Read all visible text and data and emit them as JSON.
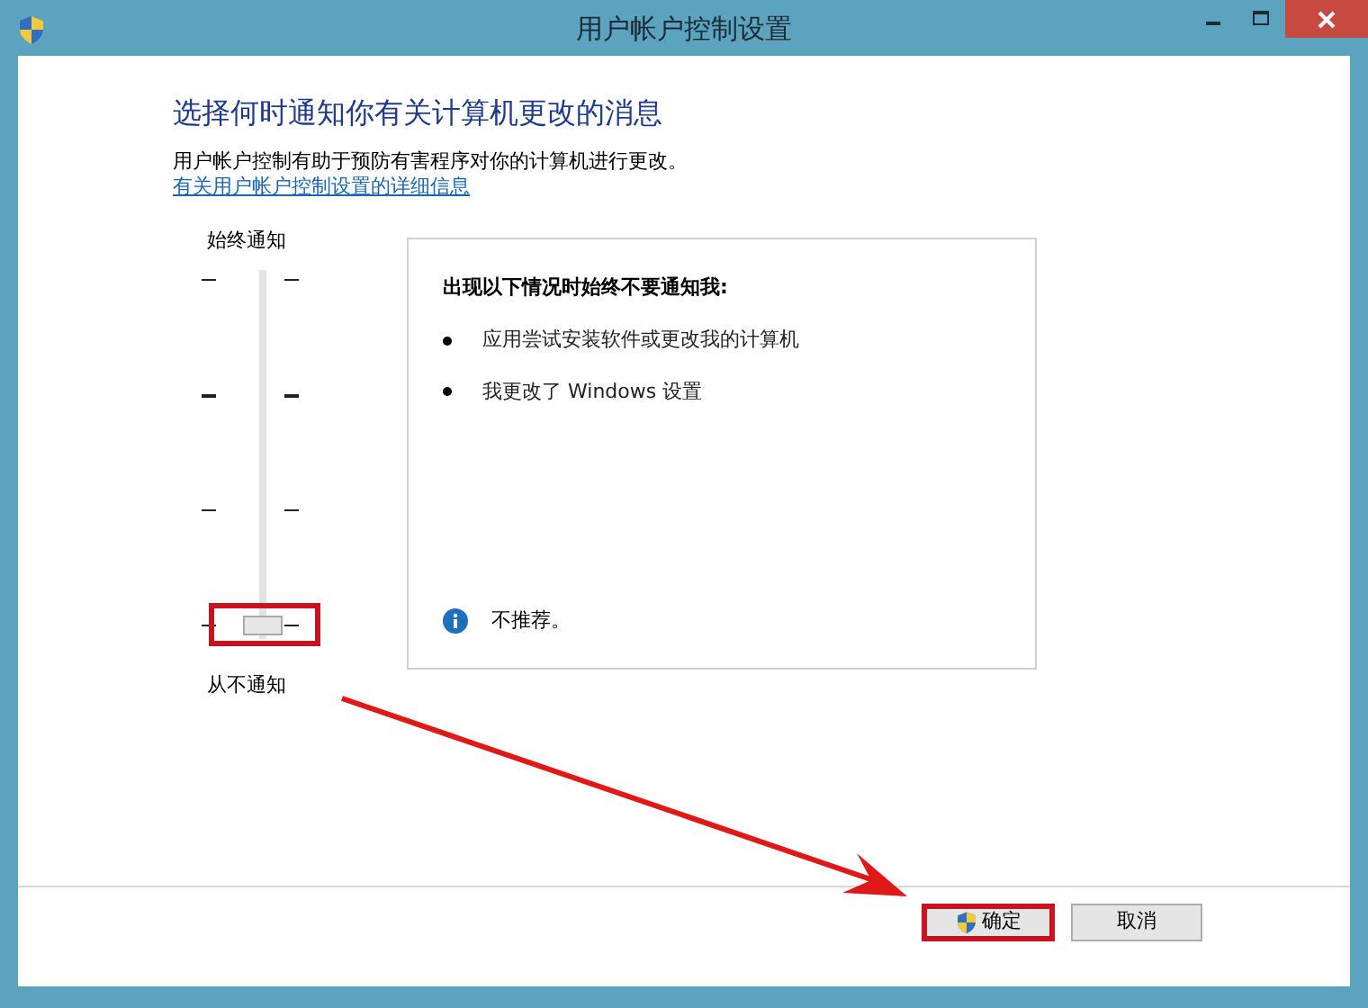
{
  "window": {
    "title": "用户帐户控制设置"
  },
  "heading": "选择何时通知你有关计算机更改的消息",
  "description": "用户帐户控制有助于预防有害程序对你的计算机进行更改。",
  "link": "有关用户帐户控制设置的详细信息",
  "slider": {
    "top_label": "始终通知",
    "bottom_label": "从不通知",
    "level": 0
  },
  "info_panel": {
    "title": "出现以下情况时始终不要通知我:",
    "bullets": [
      "应用尝试安装软件或更改我的计算机",
      "我更改了 Windows 设置"
    ],
    "note": "不推荐。"
  },
  "buttons": [
    {
      "label": "确定",
      "kind": "shield"
    },
    {
      "label": "取消",
      "kind": "plain"
    }
  ]
}
